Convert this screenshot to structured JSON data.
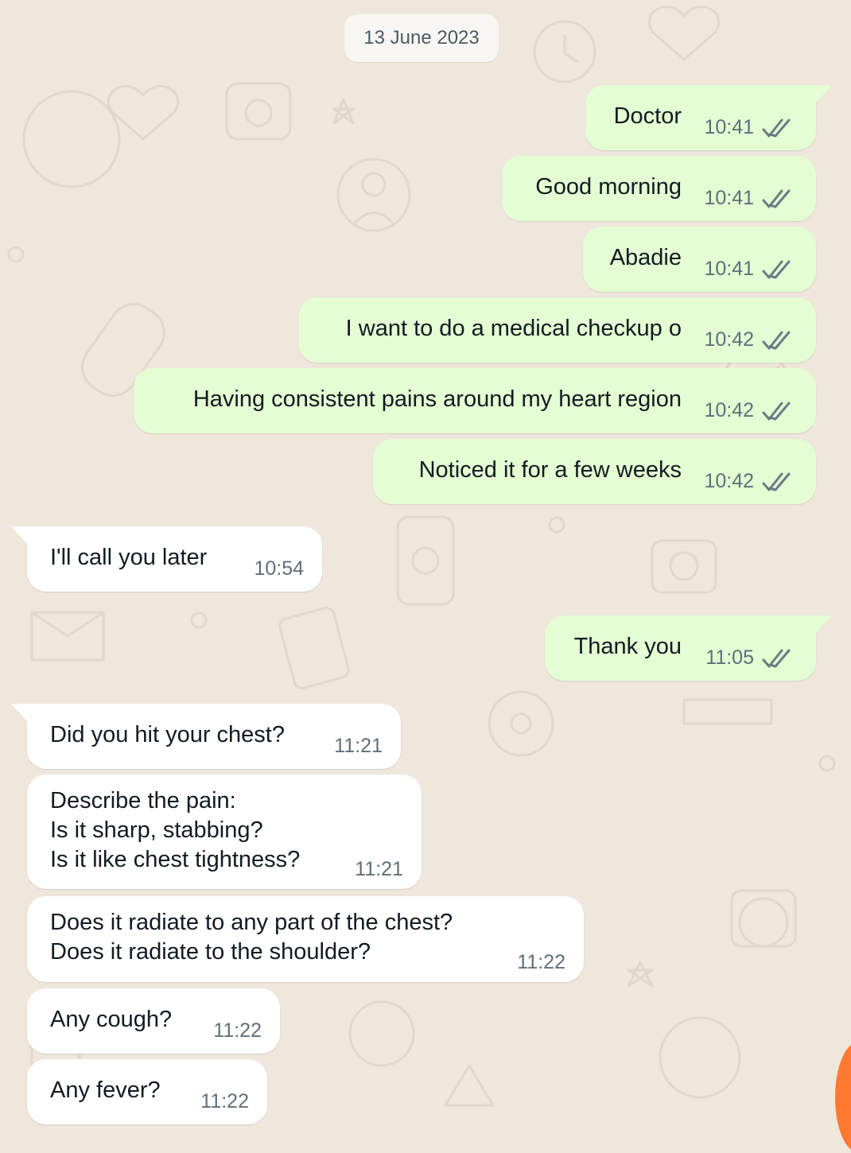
{
  "chat": {
    "date_separator": "13 June 2023",
    "messages": [
      {
        "direction": "outgoing",
        "text": "Doctor",
        "time": "10:41",
        "status": "read-ticks-icon"
      },
      {
        "direction": "outgoing",
        "text": "Good morning",
        "time": "10:41",
        "status": "read-ticks-icon"
      },
      {
        "direction": "outgoing",
        "text": "Abadie",
        "time": "10:41",
        "status": "read-ticks-icon"
      },
      {
        "direction": "outgoing",
        "text": "I want to do a medical checkup o",
        "time": "10:42",
        "status": "read-ticks-icon"
      },
      {
        "direction": "outgoing",
        "text": "Having consistent pains around my heart region",
        "time": "10:42",
        "status": "read-ticks-icon"
      },
      {
        "direction": "outgoing",
        "text": "Noticed it for a few weeks",
        "time": "10:42",
        "status": "read-ticks-icon"
      },
      {
        "direction": "incoming",
        "text": "I'll call you later",
        "time": "10:54"
      },
      {
        "direction": "outgoing",
        "text": "Thank you",
        "time": "11:05",
        "status": "read-ticks-icon"
      },
      {
        "direction": "incoming",
        "text": "Did you hit your chest?",
        "time": "11:21"
      },
      {
        "direction": "incoming",
        "text": "Describe the pain:\nIs it sharp, stabbing?\nIs it like chest tightness?",
        "time": "11:21"
      },
      {
        "direction": "incoming",
        "text": "Does it radiate to any part of the chest?\nDoes it radiate to the shoulder?",
        "time": "11:22"
      },
      {
        "direction": "incoming",
        "text": "Any cough?",
        "time": "11:22"
      },
      {
        "direction": "incoming",
        "text": "Any fever?",
        "time": "11:22"
      }
    ]
  },
  "colors": {
    "wallpaper": "#efe6dc",
    "outgoing_bubble": "#e4fdd3",
    "incoming_bubble": "#ffffff",
    "read_ticks": "#6b7a82"
  }
}
